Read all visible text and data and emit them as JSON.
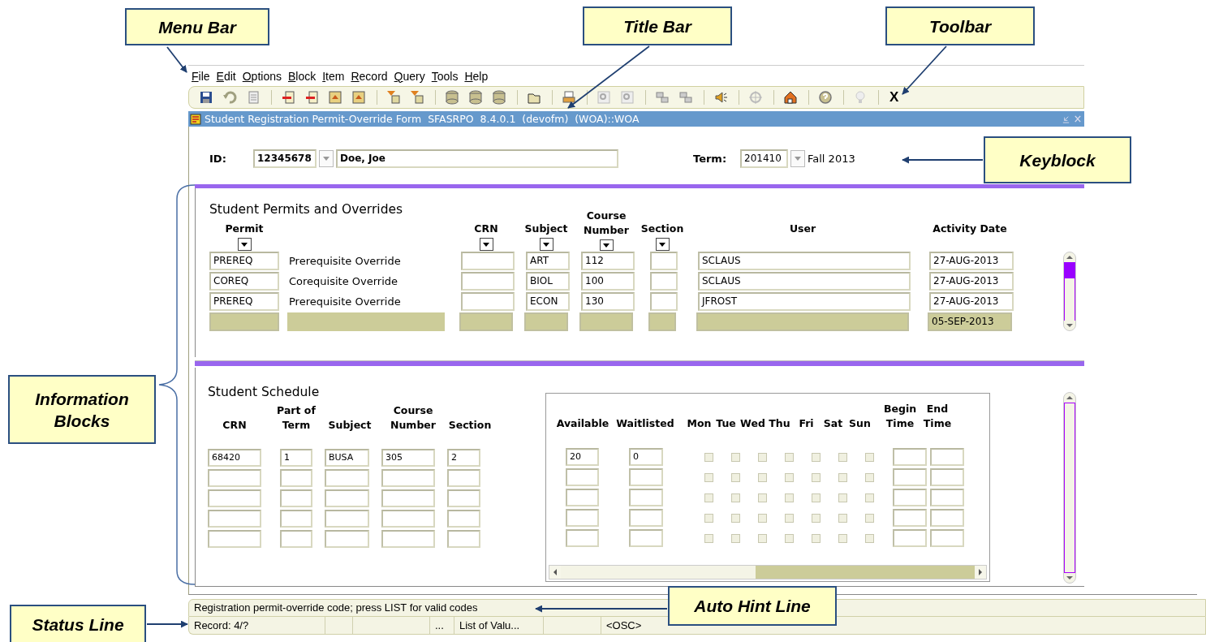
{
  "callouts": [
    {
      "label": "Menu Bar"
    },
    {
      "label": "Title Bar"
    },
    {
      "label": "Toolbar"
    },
    {
      "label": "Keyblock"
    },
    {
      "label": "Information Blocks"
    },
    {
      "label": "Auto Hint Line"
    },
    {
      "label": "Status Line"
    }
  ],
  "menu": [
    "File",
    "Edit",
    "Options",
    "Block",
    "Item",
    "Record",
    "Query",
    "Tools",
    "Help"
  ],
  "toolbar": {
    "exit_label": "X"
  },
  "window": {
    "title": "Student Registration Permit-Override Form  SFASRPO  8.4.0.1  (devofm)  (WOA)::WOA"
  },
  "keyblock": {
    "id_label": "ID:",
    "id": "12345678",
    "name": "Doe, Joe",
    "term_label": "Term:",
    "term": "201410",
    "term_desc": "Fall 2013"
  },
  "permits": {
    "title": "Student Permits and Overrides",
    "columns": [
      {
        "label": "Permit",
        "list": true
      },
      {
        "label": "CRN",
        "list": true
      },
      {
        "label": "Subject",
        "list": true
      },
      {
        "label": "Course Number",
        "list": true
      },
      {
        "label": "Section",
        "list": true
      },
      {
        "label": "User",
        "list": false
      },
      {
        "label": "Activity Date",
        "list": false
      }
    ],
    "rows": [
      {
        "permit": "PREREQ",
        "description": "Prerequisite Override",
        "subject": "ART",
        "course": "112",
        "user": "SCLAUS",
        "date": "27-AUG-2013",
        "current": false
      },
      {
        "permit": "COREQ",
        "description": "Corequisite  Override",
        "subject": "BIOL",
        "course": "100",
        "user": "SCLAUS",
        "date": "27-AUG-2013",
        "current": false
      },
      {
        "permit": "PREREQ",
        "description": "Prerequisite Override",
        "subject": "ECON",
        "course": "130",
        "user": "JFROST",
        "date": "27-AUG-2013",
        "current": false
      },
      {
        "date": "05-SEP-2013",
        "current": true
      }
    ]
  },
  "schedule": {
    "title": "Student Schedule",
    "columns": [
      "CRN",
      "Part of Term",
      "Subject",
      "Course Number",
      "Section"
    ],
    "rows": [
      {
        "crn": "68420",
        "part": "1",
        "subject": "BUSA",
        "course": "305",
        "section": "2"
      },
      {},
      {},
      {},
      {}
    ],
    "detail_columns": [
      "Available",
      "Waitlisted"
    ],
    "days": [
      "Mon",
      "Tue",
      "Wed",
      "Thu",
      "Fri",
      "Sat",
      "Sun"
    ],
    "time_columns": [
      "Begin Time",
      "End Time"
    ],
    "detail_rows": [
      {
        "available": "20",
        "waitlisted": "0",
        "days": [
          {
            "checked": false
          },
          {
            "checked": false
          },
          {
            "checked": false
          },
          {
            "checked": false
          },
          {
            "checked": false
          },
          {
            "checked": false
          },
          {
            "checked": false
          }
        ]
      },
      {
        "days": [
          {
            "checked": false
          },
          {
            "checked": false
          },
          {
            "checked": false
          },
          {
            "checked": false
          },
          {
            "checked": false
          },
          {
            "checked": false
          },
          {
            "checked": false
          }
        ]
      },
      {
        "days": [
          {
            "checked": false
          },
          {
            "checked": false
          },
          {
            "checked": false
          },
          {
            "checked": false
          },
          {
            "checked": false
          },
          {
            "checked": false
          },
          {
            "checked": false
          }
        ]
      },
      {
        "days": [
          {
            "checked": false
          },
          {
            "checked": false
          },
          {
            "checked": false
          },
          {
            "checked": false
          },
          {
            "checked": false
          },
          {
            "checked": false
          },
          {
            "checked": false
          }
        ]
      },
      {
        "days": [
          {
            "checked": false
          },
          {
            "checked": false
          },
          {
            "checked": false
          },
          {
            "checked": false
          },
          {
            "checked": false
          },
          {
            "checked": false
          },
          {
            "checked": false
          }
        ]
      }
    ]
  },
  "hint": "Registration permit-override code; press LIST for valid codes",
  "status": {
    "record": "Record: 4/?",
    "count": "...",
    "list": "List of Valu...",
    "mode": "<OSC>"
  }
}
